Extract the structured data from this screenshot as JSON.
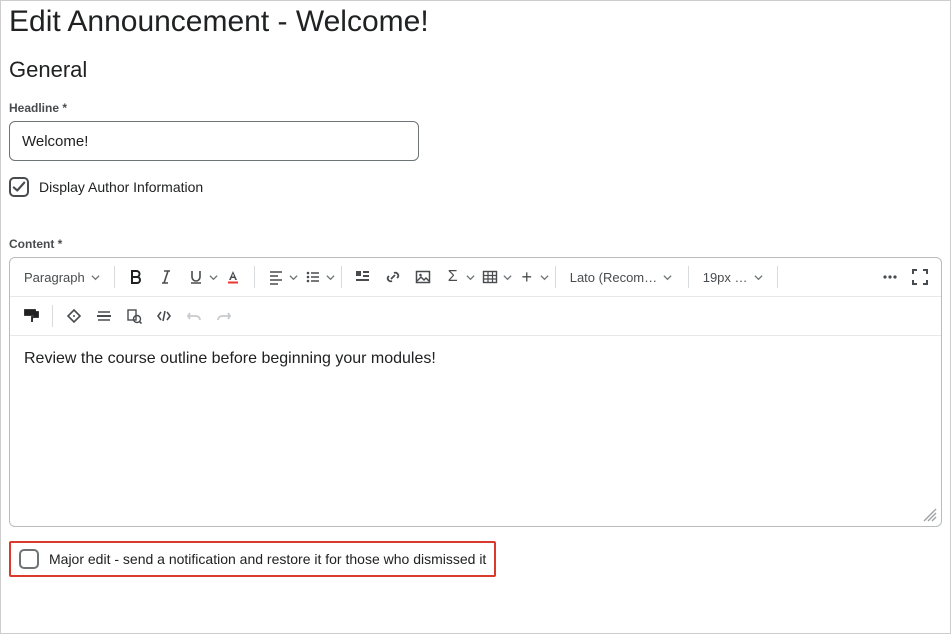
{
  "page": {
    "title": "Edit Announcement - Welcome!"
  },
  "general": {
    "heading": "General",
    "headline_label": "Headline *",
    "headline_value": "Welcome!",
    "display_author_label": "Display Author Information",
    "display_author_checked": true
  },
  "content": {
    "label": "Content *",
    "body": "Review the course outline before beginning your modules!"
  },
  "toolbar": {
    "paragraph": "Paragraph",
    "font_family": "Lato (Recom…",
    "font_size": "19px …"
  },
  "major_edit": {
    "label": "Major edit - send a notification and restore it for those who dismissed it",
    "checked": false
  }
}
